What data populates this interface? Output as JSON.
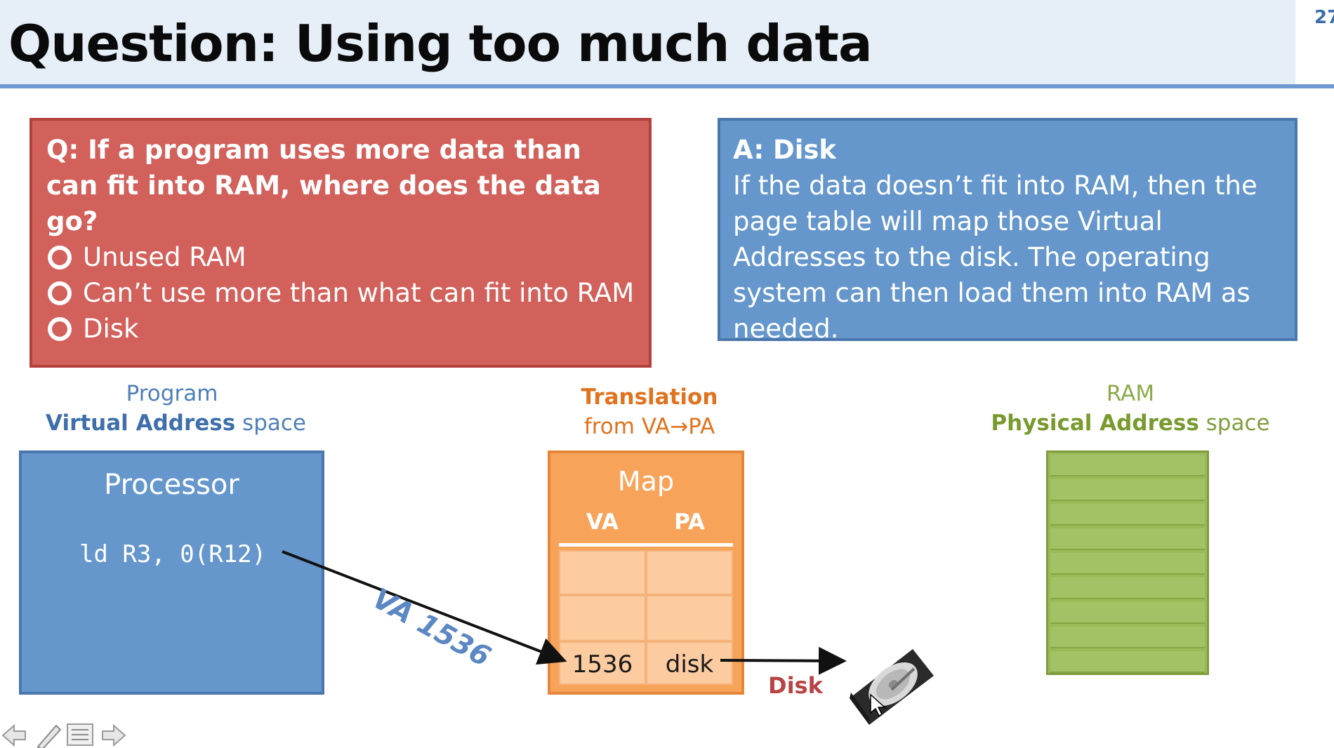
{
  "slide": {
    "title": "Question: Using too much data",
    "number": "27"
  },
  "question": {
    "text": "Q: If a program uses more data than can fit into RAM, where does the data go?",
    "options": [
      "Unused RAM",
      "Can’t use more than what can fit into RAM",
      "Disk"
    ]
  },
  "answer": {
    "title": "A: Disk",
    "body": "If the data doesn’t fit into RAM, then the page table will map those Virtual Addresses to the disk. The operating system can then load them into RAM as needed."
  },
  "program_caption": {
    "line1": "Program",
    "line2_strong": "Virtual Address",
    "line2_rest": " space"
  },
  "translation_caption": {
    "line1": "Translation",
    "line2": "from VA→PA"
  },
  "ram_caption": {
    "line1": "RAM",
    "line2_strong": "Physical Address",
    "line2_rest": " space"
  },
  "processor": {
    "title": "Processor",
    "code": "ld R3, 0(R12)"
  },
  "map": {
    "title": "Map",
    "head_va": "VA",
    "head_pa": "PA",
    "last_va": "1536",
    "last_pa": "disk"
  },
  "arrow_label": "VA 1536",
  "disk_label": "Disk",
  "ram_rows": 9,
  "colors": {
    "question_bg": "#d2605b",
    "answer_bg": "#6597cc",
    "map_bg": "#f8a35a",
    "ram_bg": "#9aba59"
  },
  "nav_icons": [
    "arrow-left-icon",
    "pen-icon",
    "menu-icon",
    "arrow-right-icon"
  ]
}
